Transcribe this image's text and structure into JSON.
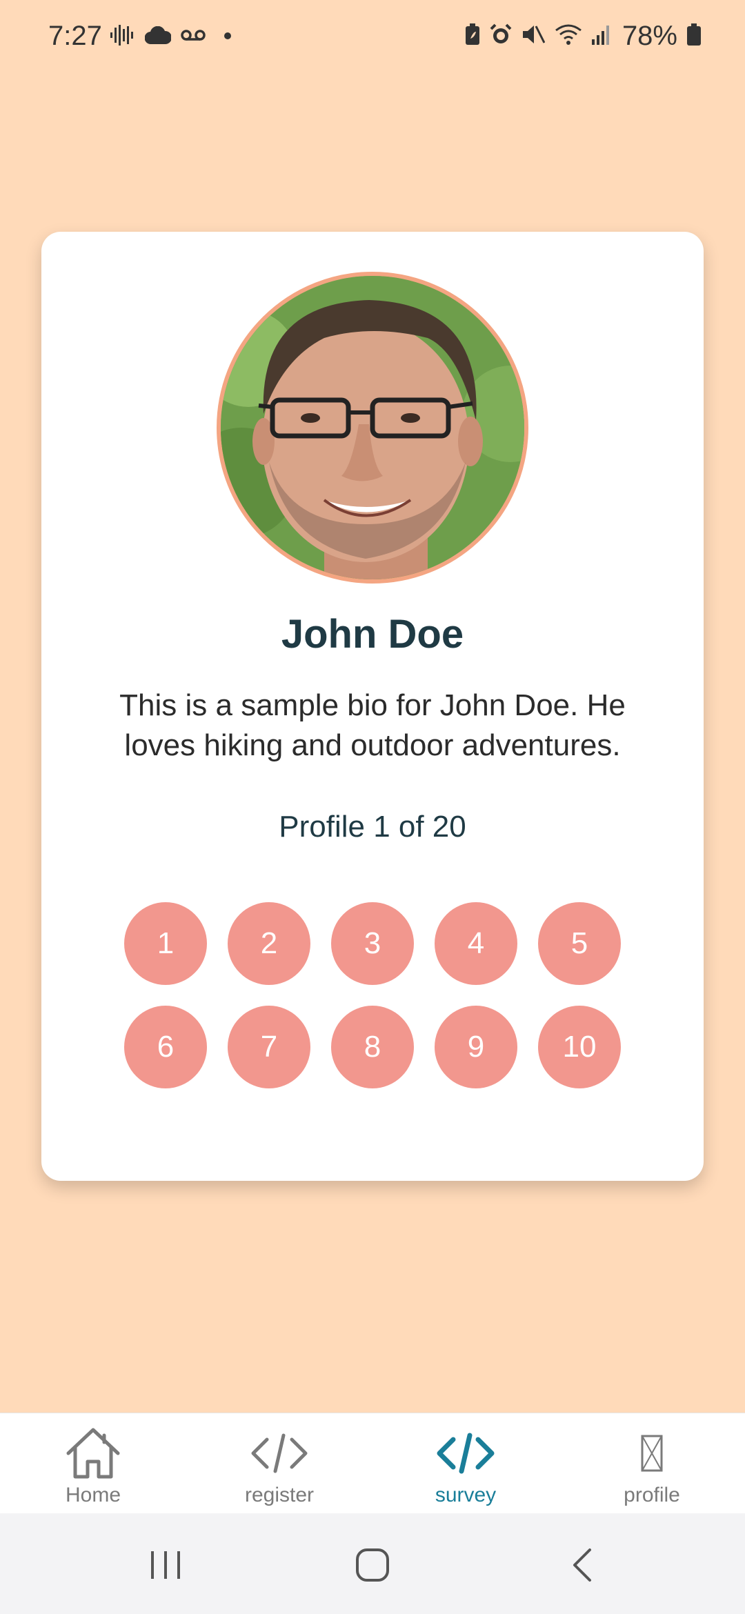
{
  "status_bar": {
    "time": "7:27",
    "battery": "78%",
    "left_icons": [
      "soundwave-icon",
      "cloud-icon",
      "voicemail-icon",
      "dot-icon"
    ],
    "right_icons": [
      "battery-saver-icon",
      "alarm-icon",
      "mute-icon",
      "wifi-icon",
      "signal-icon",
      "battery-icon"
    ]
  },
  "profile": {
    "name": "John Doe",
    "bio": "This is a sample bio for John Doe. He loves hiking and outdoor adventures.",
    "counter": "Profile 1 of 20",
    "ratings": [
      "1",
      "2",
      "3",
      "4",
      "5",
      "6",
      "7",
      "8",
      "9",
      "10"
    ]
  },
  "tabs": [
    {
      "label": "Home",
      "icon": "home-icon",
      "active": false
    },
    {
      "label": "register",
      "icon": "code-icon",
      "active": false
    },
    {
      "label": "survey",
      "icon": "code-icon",
      "active": true
    },
    {
      "label": "profile",
      "icon": "missing-glyph-icon",
      "active": false
    }
  ],
  "colors": {
    "background": "#FFDAB9",
    "card": "#FFFFFF",
    "rating_button": "#F2978E",
    "avatar_border": "#F4A582",
    "title": "#1F3A44",
    "active_tab": "#1A7E99",
    "inactive_tab": "#7A7A7A"
  }
}
